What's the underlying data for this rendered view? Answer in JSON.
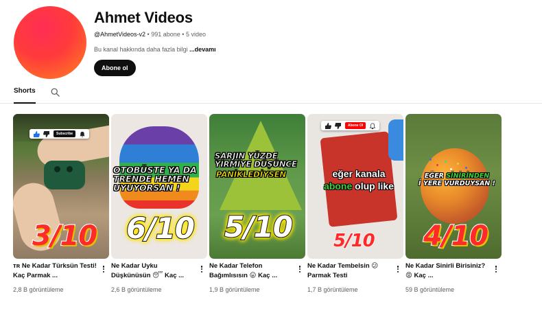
{
  "channel": {
    "name": "Ahmet Videos",
    "handle": "@AhmetVideos-v2",
    "subscribers": "991 abone",
    "video_count": "5 video",
    "separator": "•",
    "description": "Bu kanal hakkında daha fazla bilgi",
    "more_label": "...devamı",
    "subscribe_label": "Abone ol",
    "avatar_color": "#ff3b3b"
  },
  "tabs": {
    "shorts_label": "Shorts",
    "search_icon": "search-icon"
  },
  "shorts": [
    {
      "title": "ᴛʀ Ne Kadar Türksün Testi! Kaç Parmak ...",
      "views": "2,8 B görüntüleme",
      "score": "3/10",
      "overlay_sub": "Subscribe"
    },
    {
      "title": "Ne Kadar Uyku Düşkünüsün 😴 Kaç ...",
      "views": "2,6 B görüntüleme",
      "score": "6/10",
      "caption": "OTOBÜSTE YA DA TRENDE HEMEN UYUYORSAN !"
    },
    {
      "title": "Ne Kadar Telefon Bağımlısısın 😛 Kaç ...",
      "views": "1,9 B görüntüleme",
      "score": "5/10",
      "caption_white": "ŞARJIN YÜZDE YİRMİYE DÜŞÜNCE",
      "caption_yellow": "PANİKLEDİYSEN"
    },
    {
      "title": "Ne Kadar Tembelsin 😕 Parmak Testi",
      "views": "1,7 B görüntüleme",
      "score": "5/10",
      "overlay_sub": "Abone Ol",
      "caption_pre": "eğer kanala",
      "caption_green": "abone",
      "caption_post": "olup like"
    },
    {
      "title": "Ne Kadar Sinirli Birisiniz? 😡 Kaç ...",
      "views": "59 B görüntüleme",
      "score": "4/10",
      "caption_pre": "EĞER",
      "caption_green": "SİNİRİNDEN",
      "caption_post": "İ YERE VURDUYSAN !"
    }
  ]
}
